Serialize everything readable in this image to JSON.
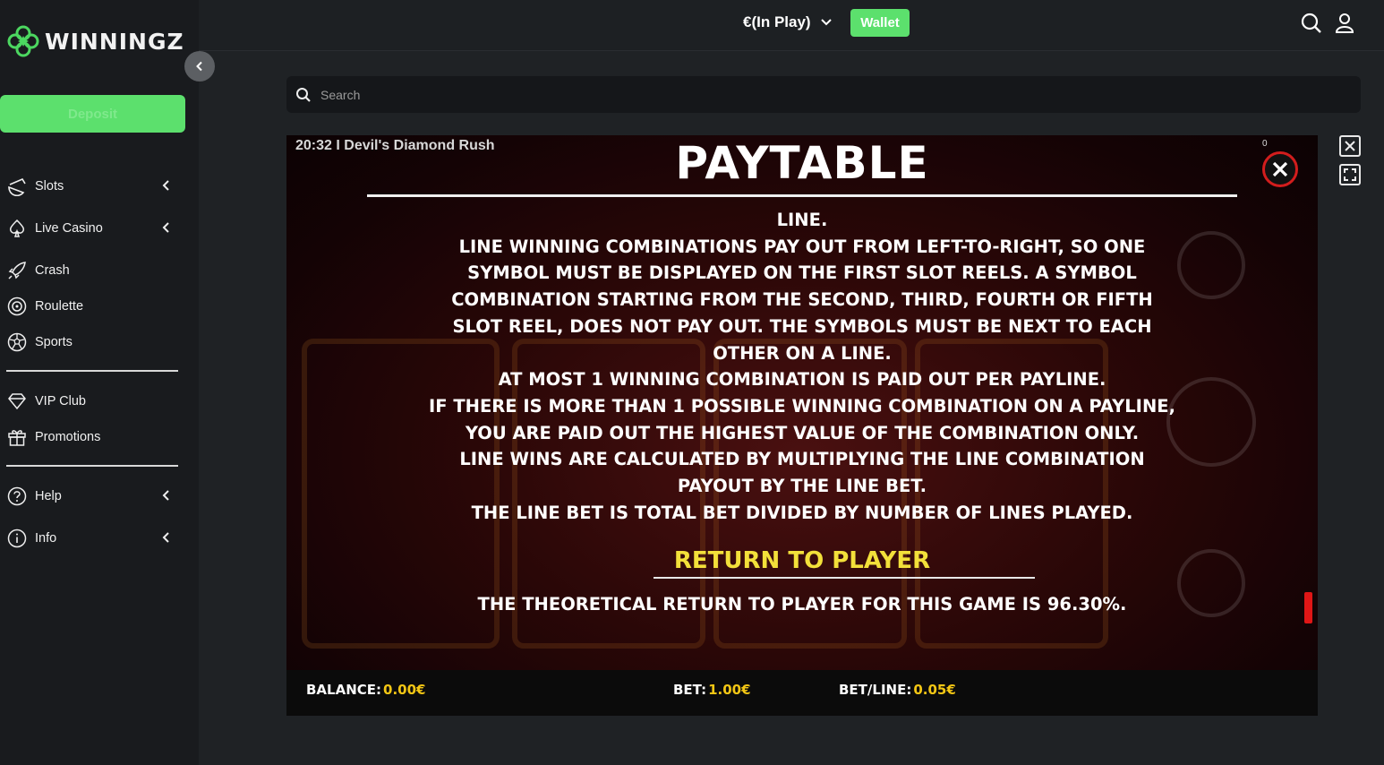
{
  "sidebar": {
    "logo_text": "WINNINGZ",
    "deposit_label": "Deposit",
    "items": [
      {
        "label": "Slots",
        "icon": "watermelon-icon"
      },
      {
        "label": "Live Casino",
        "icon": "spade-icon"
      },
      {
        "label": "Crash",
        "icon": "rocket-icon"
      },
      {
        "label": "Roulette",
        "icon": "roulette-icon"
      },
      {
        "label": "Sports",
        "icon": "soccer-ball-icon"
      },
      {
        "label": "VIP Club",
        "icon": "diamond-icon"
      },
      {
        "label": "Promotions",
        "icon": "gift-icon"
      },
      {
        "label": "Help",
        "icon": "question-circle-icon"
      },
      {
        "label": "Info",
        "icon": "info-circle-icon"
      }
    ]
  },
  "header": {
    "balance_label": "€(In Play)",
    "wallet_label": "Wallet"
  },
  "search": {
    "placeholder": "Search"
  },
  "game": {
    "time_title": "20:32 I Devil's Diamond Rush",
    "counter": "0",
    "paytable_title": "PAYTABLE",
    "paytable_lines": [
      "LINE.",
      "LINE WINNING COMBINATIONS PAY OUT FROM LEFT-TO-RIGHT, SO ONE",
      "SYMBOL MUST BE DISPLAYED ON THE FIRST SLOT REELS. A SYMBOL",
      "COMBINATION STARTING FROM THE SECOND, THIRD, FOURTH OR FIFTH",
      "SLOT REEL, DOES NOT PAY OUT. THE SYMBOLS MUST BE NEXT TO EACH",
      "OTHER ON A LINE.",
      "AT MOST 1 WINNING COMBINATION IS PAID OUT PER PAYLINE.",
      "IF THERE IS MORE THAN 1 POSSIBLE WINNING COMBINATION ON A PAYLINE,",
      "YOU ARE PAID OUT THE HIGHEST VALUE OF THE COMBINATION ONLY.",
      "LINE WINS ARE CALCULATED BY MULTIPLYING THE LINE COMBINATION",
      "PAYOUT BY THE LINE BET.",
      "THE LINE BET IS TOTAL BET DIVIDED BY NUMBER OF LINES PLAYED."
    ],
    "rtp_title": "RETURN TO PLAYER",
    "rtp_text": "THE THEORETICAL RETURN TO PLAYER FOR THIS GAME IS 96.30%.",
    "footer": {
      "balance_label": "BALANCE:",
      "balance_value": "0.00€",
      "bet_label": "BET:",
      "bet_value": "1.00€",
      "betline_label": "BET/LINE:",
      "betline_value": "0.05€"
    }
  },
  "colors": {
    "accent_green": "#5ce06d",
    "rtp_yellow": "#f3e03a",
    "value_yellow": "#f3c614",
    "close_red": "#d21d1d"
  }
}
